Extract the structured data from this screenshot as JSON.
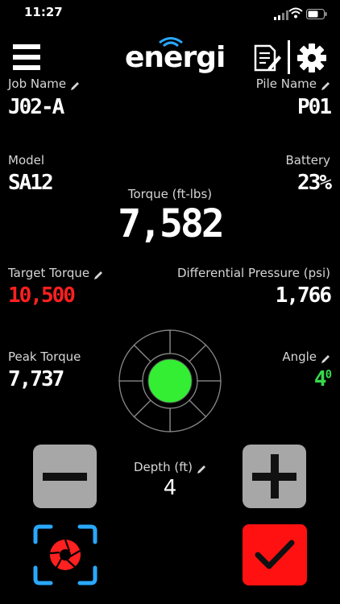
{
  "status_bar": {
    "time": "11:27"
  },
  "header": {
    "logo_text": "energi",
    "logo_accent": "#29a8ff"
  },
  "job_name": {
    "label": "Job Name",
    "value": "J02-A"
  },
  "pile_name": {
    "label": "Pile Name",
    "value": "P01"
  },
  "model": {
    "label": "Model",
    "value": "SA12"
  },
  "battery": {
    "label": "Battery",
    "value": "23%"
  },
  "torque": {
    "label": "Torque (ft-lbs)",
    "value": "7,582"
  },
  "target_torque": {
    "label": "Target Torque",
    "value": "10,500",
    "color": "#ff2020"
  },
  "differential_pressure": {
    "label": "Differential Pressure (psi)",
    "value": "1,766"
  },
  "peak_torque": {
    "label": "Peak Torque",
    "value": "7,737"
  },
  "angle": {
    "label": "Angle",
    "value": "4",
    "unit": "0",
    "color": "#37d94a"
  },
  "depth": {
    "label": "Depth (ft)",
    "value": "4"
  },
  "indicator": {
    "center_color": "#33ee33"
  }
}
